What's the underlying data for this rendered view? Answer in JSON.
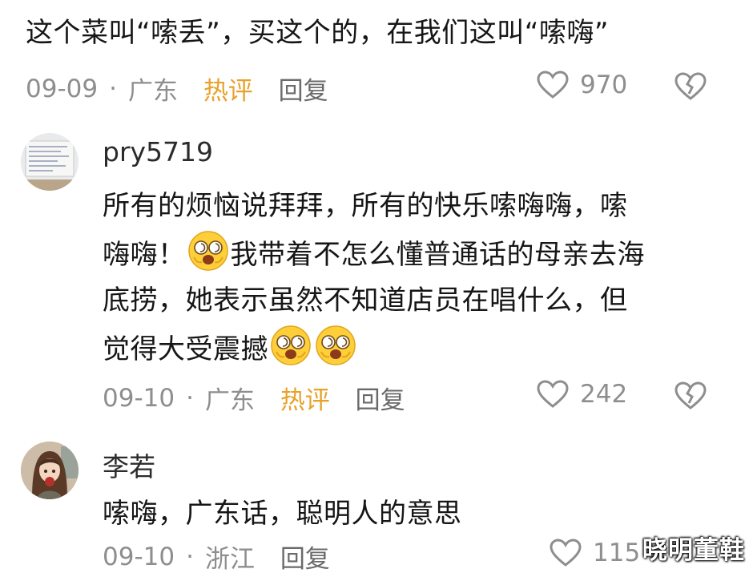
{
  "comments": [
    {
      "text": "这个菜叫“嗦丢”，买这个的，在我们这叫“嗦嗨”",
      "date": "09-09",
      "location": "广东",
      "hot": "热评",
      "reply": "回复",
      "likes": "970"
    },
    {
      "username": "pry5719",
      "avatar_icon": "note-photo-avatar-icon",
      "line1": "所有的烦恼说拜拜，所有的快乐嗦嗨嗨，嗦",
      "line2": "嗨嗨！",
      "line2b": "我带着不怎么懂普通话的母亲去海",
      "line3": "底捞，她表示虽然不知道店员在唱什么，但",
      "line4": "觉得大受震撼",
      "date": "09-10",
      "location": "广东",
      "hot": "热评",
      "reply": "回复",
      "likes": "242"
    },
    {
      "username": "李若",
      "avatar_icon": "anime-girl-avatar-icon",
      "text": "嗦嗨，广东话，聪明人的意思",
      "date": "09-10",
      "location": "浙江",
      "reply": "回复",
      "likes": "115"
    }
  ],
  "separator": "·",
  "watermark": "晓明董鞋",
  "colors": {
    "hot": "#e8a22a",
    "meta": "#8e8e8e",
    "text": "#161616"
  }
}
